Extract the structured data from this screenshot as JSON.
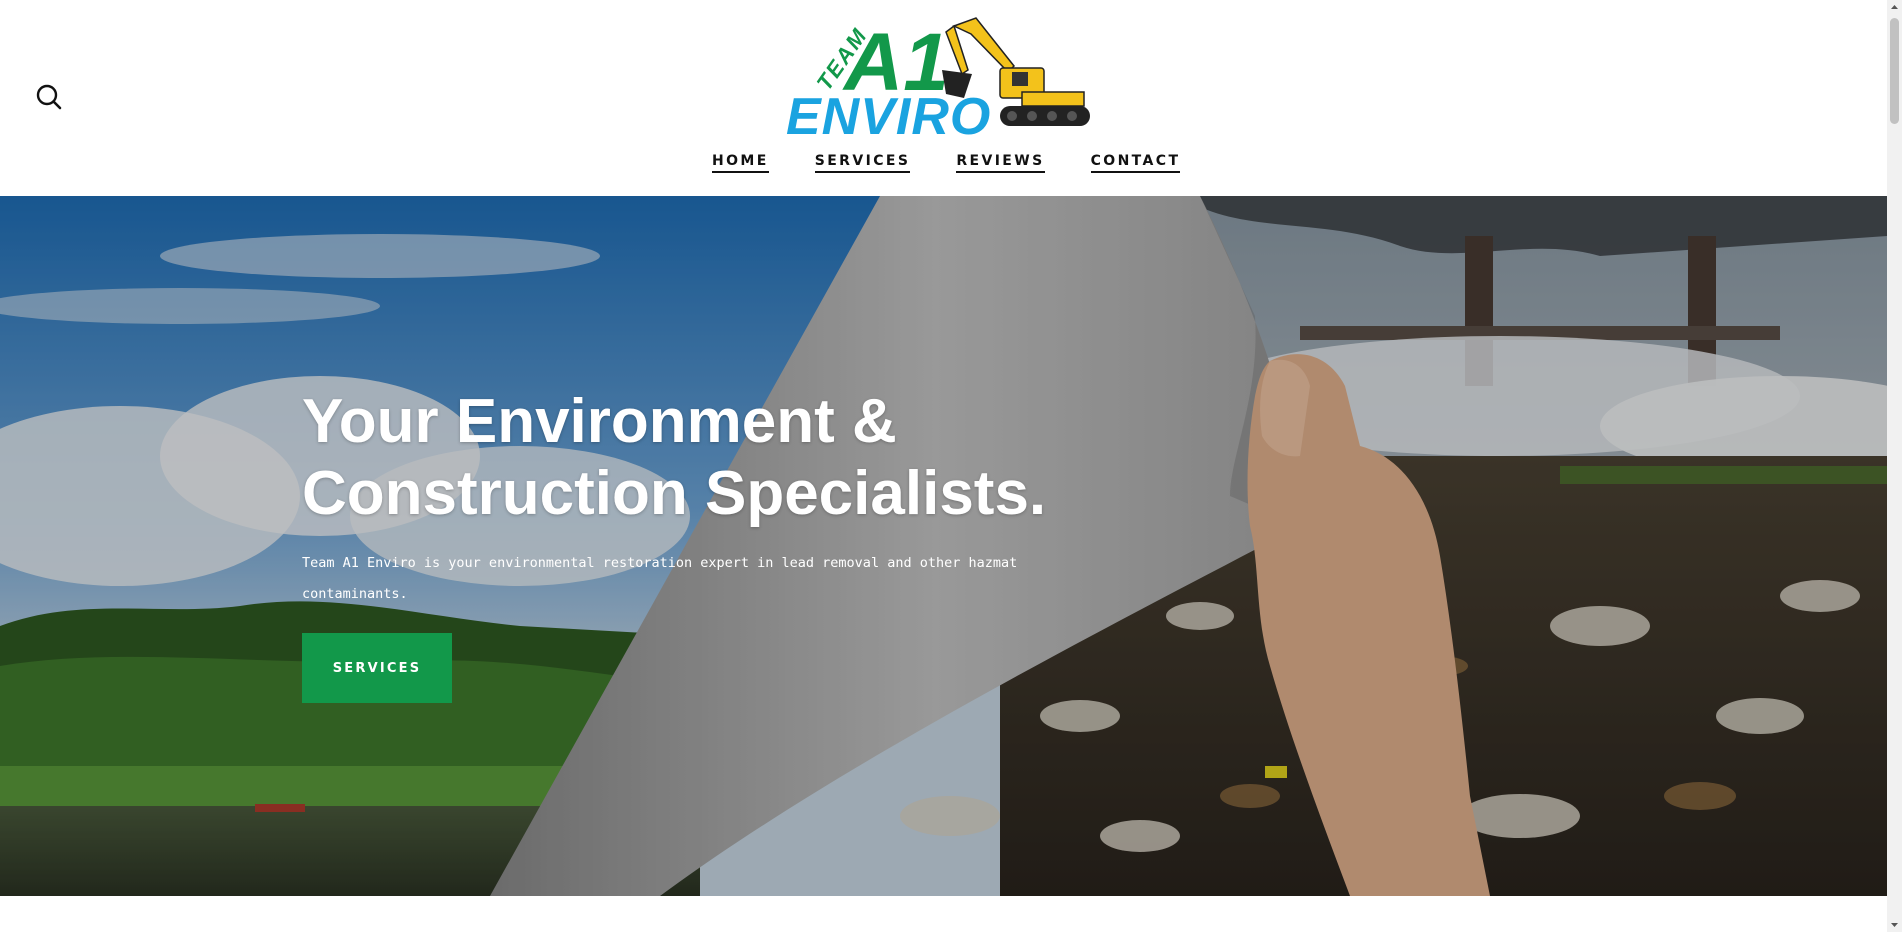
{
  "header": {
    "logo": {
      "team": "TEAM",
      "a1": "A1",
      "enviro": "ENVIRO"
    },
    "search_icon": "search-icon"
  },
  "nav": {
    "items": [
      {
        "label": "HOME"
      },
      {
        "label": "SERVICES"
      },
      {
        "label": "REVIEWS"
      },
      {
        "label": "CONTACT"
      }
    ]
  },
  "hero": {
    "title_line1": "Your Environment &",
    "title_line2": "Construction Specialists.",
    "subtitle": "Team A1 Enviro is your environmental restoration expert in lead removal and other hazmat contaminants.",
    "button_label": "SERVICES"
  },
  "colors": {
    "brand_green": "#12984a",
    "brand_blue": "#1aa3e0",
    "excavator_yellow": "#f3c21b"
  }
}
